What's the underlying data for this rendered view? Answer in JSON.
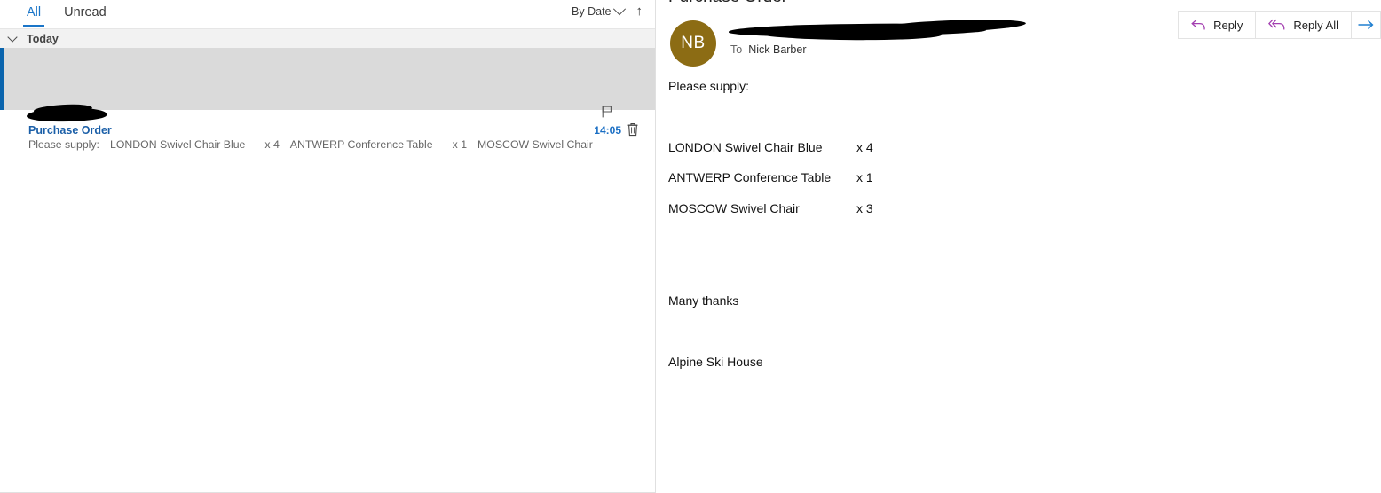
{
  "list_pane": {
    "tabs": [
      {
        "label": "All",
        "active": true
      },
      {
        "label": "Unread",
        "active": false
      }
    ],
    "sort": {
      "label": "By Date",
      "direction_icon": "up-arrow-icon",
      "chevron_icon": "chevron-down-icon"
    },
    "group": {
      "title": "Today",
      "chevron_icon": "chevron-down-icon"
    },
    "message": {
      "sender": "",
      "sender_redacted": true,
      "subject": "Purchase Order",
      "preview_prefix": "Please supply:",
      "preview_item1": "LONDON Swivel Chair Blue",
      "preview_qty1": "x 4",
      "preview_item2": "ANTWERP Conference Table",
      "preview_qty2": "x 1",
      "preview_item3": "MOSCOW Swivel Chair",
      "time": "14:05",
      "flag_icon": "flag-icon",
      "delete_icon": "trash-icon"
    }
  },
  "reading_pane": {
    "subject": "Purchase Order",
    "avatar_initials": "NB",
    "avatar_color": "#8c6c14",
    "sender": "",
    "sender_redacted": true,
    "to_label": "To",
    "to_name": "Nick Barber",
    "body": {
      "intro": "Please supply:",
      "items": [
        {
          "name": "LONDON Swivel Chair Blue",
          "qty": "x 4"
        },
        {
          "name": "ANTWERP Conference Table",
          "qty": "x 1"
        },
        {
          "name": "MOSCOW Swivel Chair",
          "qty": "x 3"
        }
      ],
      "thanks": "Many thanks",
      "signoff": "Alpine Ski House"
    },
    "actions": [
      {
        "label": "Reply",
        "icon": "reply-arrow-icon"
      },
      {
        "label": "Reply All",
        "icon": "reply-all-arrow-icon"
      }
    ],
    "forward": {
      "icon": "forward-arrow-icon"
    }
  },
  "colors": {
    "accent_blue": "#1a75c8",
    "link_blue": "#1b5fa8",
    "selection_bar": "#0a64ad",
    "selected_row_bg": "#dadada",
    "group_header_bg": "#f2f2f2",
    "reply_icon_purple": "#a33fb0",
    "forward_icon_blue": "#1f7fd0"
  }
}
